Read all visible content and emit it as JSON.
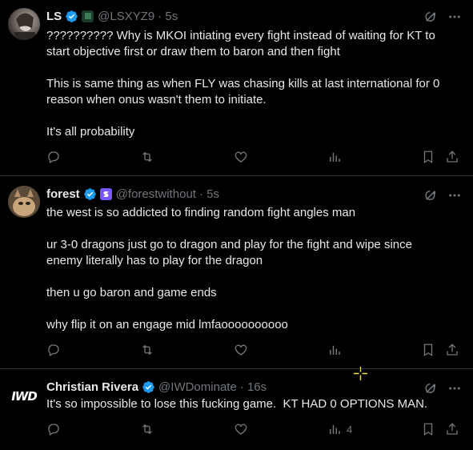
{
  "tweets": [
    {
      "name": "LS",
      "handle": "@LSXYZ9",
      "time": "· 5s",
      "lines": [
        "?????????? Why is MKOI intiating every fight instead of waiting for KT to start objective first or draw them to baron and then fight",
        "",
        "This is same thing as when FLY was chasing kills at last international for 0 reason when onus wasn't them to initiate.",
        "",
        "It's all probability"
      ],
      "views": ""
    },
    {
      "name": "forest",
      "handle": "@forestwithout",
      "time": "· 5s",
      "lines": [
        "the west is so addicted to finding random fight angles man",
        "",
        "ur 3-0 dragons just go to dragon and play for the fight and wipe since enemy literally has to play for the dragon",
        "",
        "then u go baron and game ends",
        "",
        "why flip it on an engage mid lmfaoooooooooo"
      ],
      "views": ""
    },
    {
      "name": "Christian Rivera",
      "handle": "@IWDominate",
      "time": "· 16s",
      "lines": [
        "It's so impossible to lose this fucking game.  KT HAD 0 OPTIONS MAN."
      ],
      "views": "4"
    }
  ],
  "avatar_logo_text": "IWD",
  "colors": {
    "verified": "#1d9bf0",
    "muted": "#71767b",
    "divider": "#2f3336",
    "affiliate_badge": "#7856ff"
  },
  "icons": [
    "reply-icon",
    "retweet-icon",
    "like-icon",
    "views-icon",
    "bookmark-icon",
    "share-icon",
    "grok-icon",
    "more-icon",
    "verified-icon"
  ]
}
